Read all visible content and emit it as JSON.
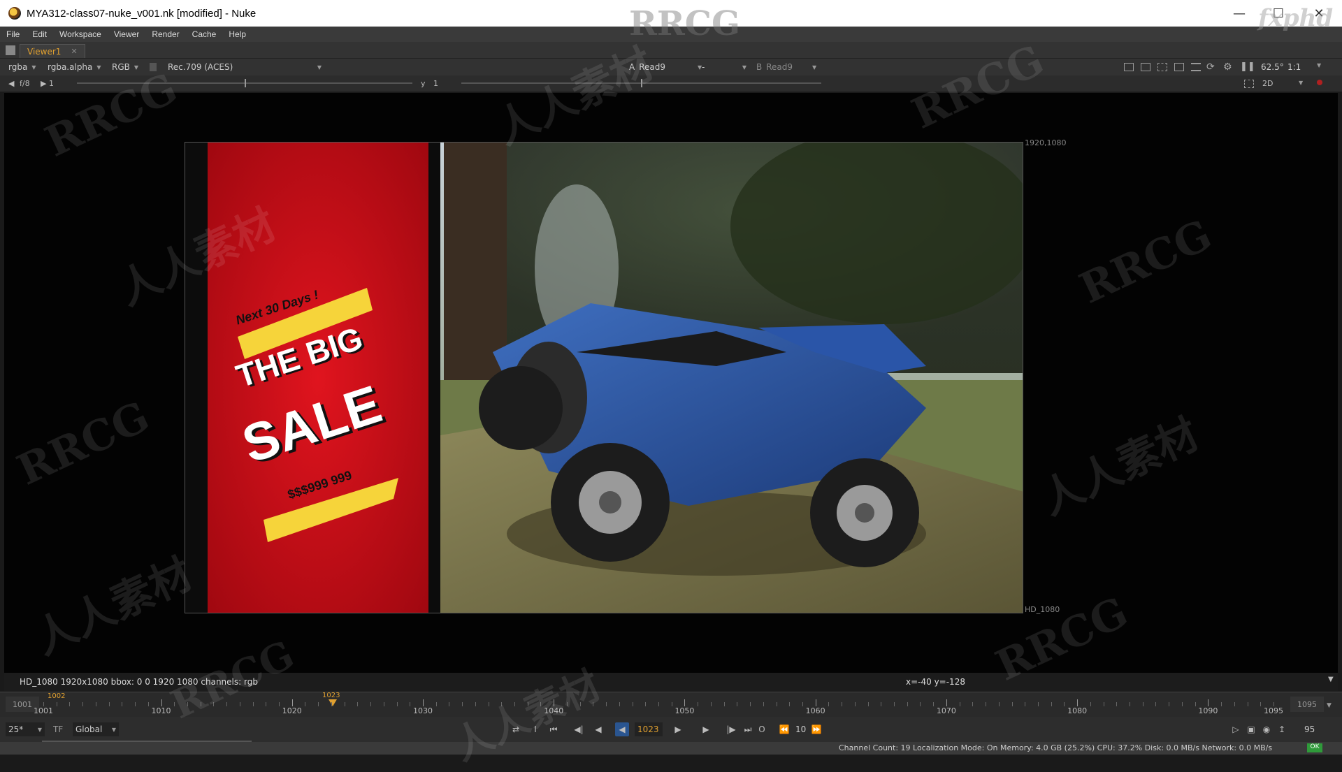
{
  "window": {
    "title": "MYA312-class07-nuke_v001.nk [modified] - Nuke",
    "controls": [
      "minimize-icon",
      "maximize-icon",
      "close-icon"
    ]
  },
  "menubar": [
    "File",
    "Edit",
    "Workspace",
    "Viewer",
    "Render",
    "Cache",
    "Help"
  ],
  "tabs": [
    {
      "label": "Viewer1",
      "active": true
    }
  ],
  "viewer_toolbar": {
    "channels": "rgba",
    "alpha_channel": "rgba.alpha",
    "display": "RGB",
    "colorspace": "Rec.709 (ACES)",
    "input_a_label": "A",
    "input_a": "Read9",
    "operation": "-",
    "input_b_label": "B",
    "input_b": "Read9",
    "zoom": "62.5°",
    "proxy": "1:1"
  },
  "viewer_toolbar2": {
    "fstop": "f/8",
    "gain_value": "1",
    "gamma_label": "y",
    "gamma_value": "1",
    "view_mode": "2D"
  },
  "viewer": {
    "format_corner_label": "1920,1080",
    "format_name_label": "HD_1080",
    "image": {
      "banner_top": "Next 30 Days !",
      "banner_line1": "THE BIG",
      "banner_line2": "SALE",
      "banner_price": "$$$999 999"
    }
  },
  "info_bar": {
    "format_info": "HD_1080 1920x1080  bbox: 0 0 1920 1080 channels: rgb",
    "cursor_info": "x=-40 y=-128"
  },
  "timeline": {
    "in_frame": "1001",
    "out_frame": "1095",
    "current_frame": "1023",
    "in_marker": "1002",
    "labels": [
      "1001",
      "1010",
      "1020",
      "1030",
      "1040",
      "1050",
      "1060",
      "1070",
      "1080",
      "1090",
      "1095"
    ]
  },
  "playback": {
    "fps": "25*",
    "tf": "TF",
    "range_mode": "Global",
    "frame": "1023",
    "increment": "10",
    "end_frame": "95"
  },
  "status_bar": "Channel Count: 19  Localization Mode: On  Memory: 4.0 GB (25.2%)  CPU: 37.2%  Disk: 0.0 MB/s  Network: 0.0 MB/s",
  "status_indicator": "OK",
  "watermark": {
    "brand": "RRCG",
    "cn": "人人素材",
    "corner": "fxphd"
  },
  "colors": {
    "accent_orange": "#e0a030",
    "banner_red": "#d8101c",
    "banner_yellow": "#f6d43a",
    "car_blue": "#2a55a8"
  }
}
